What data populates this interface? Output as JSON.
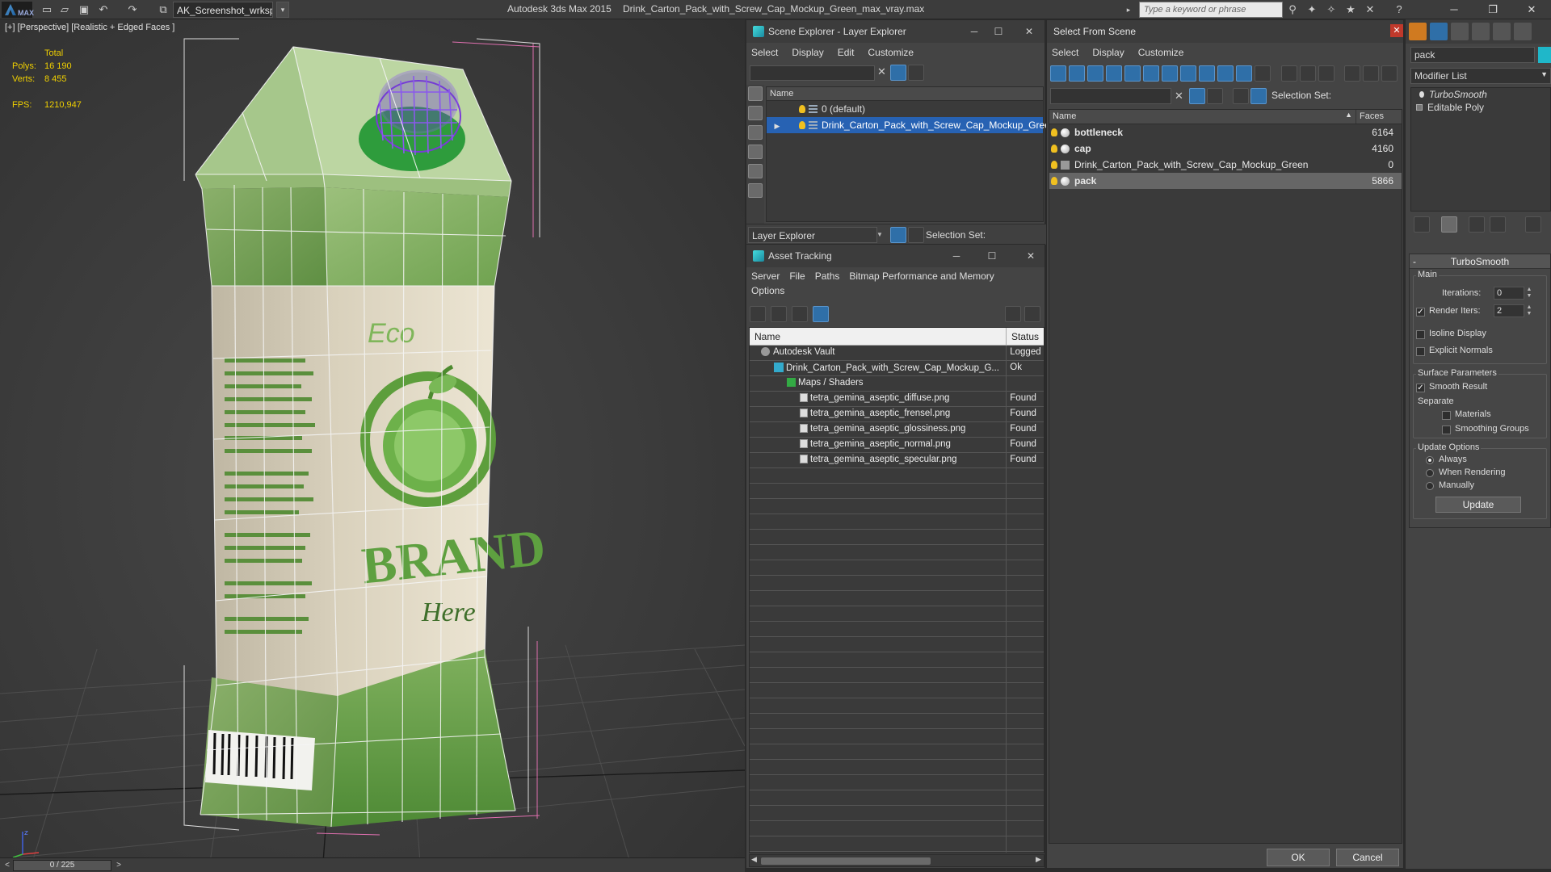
{
  "titlebar": {
    "logo": "MAX",
    "workspace": "AK_Screenshot_wrksp",
    "app_title": "Autodesk 3ds Max  2015",
    "file_title": "Drink_Carton_Pack_with_Screw_Cap_Mockup_Green_max_vray.max",
    "search_placeholder": "Type a keyword or phrase"
  },
  "viewport": {
    "label": "[+] [Perspective] [Realistic + Edged Faces ]",
    "stats": {
      "total_label": "Total",
      "polys_label": "Polys:",
      "polys_value": "16 190",
      "verts_label": "Verts:",
      "verts_value": "8 455",
      "fps_label": "FPS:",
      "fps_value": "1210,947"
    },
    "carton_text": {
      "eco": "Eco",
      "brand": "BRAND",
      "here": "Here"
    },
    "time_slider": "0 / 225"
  },
  "scene_explorer": {
    "title": "Scene Explorer - Layer Explorer",
    "menu": [
      "Select",
      "Display",
      "Edit",
      "Customize"
    ],
    "column": "Name",
    "rows": [
      {
        "label": "0 (default)",
        "selected": false
      },
      {
        "label": "Drink_Carton_Pack_with_Screw_Cap_Mockup_Green",
        "selected": true
      }
    ],
    "mode": "Layer Explorer",
    "selection_set": "Selection Set:"
  },
  "asset_tracking": {
    "title": "Asset Tracking",
    "menu": [
      "Server",
      "File",
      "Paths",
      "Bitmap Performance and Memory"
    ],
    "menu2": "Options",
    "columns": [
      "Name",
      "Status"
    ],
    "rows": [
      {
        "name": "Autodesk Vault",
        "status": "Logged",
        "indent": 1,
        "type": "vault"
      },
      {
        "name": "Drink_Carton_Pack_with_Screw_Cap_Mockup_G...",
        "status": "Ok",
        "indent": 2,
        "type": "max"
      },
      {
        "name": "Maps / Shaders",
        "status": "",
        "indent": 3,
        "type": "group"
      },
      {
        "name": "tetra_gemina_aseptic_diffuse.png",
        "status": "Found",
        "indent": 4,
        "type": "file"
      },
      {
        "name": "tetra_gemina_aseptic_frensel.png",
        "status": "Found",
        "indent": 4,
        "type": "file"
      },
      {
        "name": "tetra_gemina_aseptic_glossiness.png",
        "status": "Found",
        "indent": 4,
        "type": "file"
      },
      {
        "name": "tetra_gemina_aseptic_normal.png",
        "status": "Found",
        "indent": 4,
        "type": "file"
      },
      {
        "name": "tetra_gemina_aseptic_specular.png",
        "status": "Found",
        "indent": 4,
        "type": "file"
      }
    ]
  },
  "select_from_scene": {
    "title": "Select From Scene",
    "menu": [
      "Select",
      "Display",
      "Customize"
    ],
    "selection_set": "Selection Set:",
    "columns": [
      "Name",
      "Faces"
    ],
    "rows": [
      {
        "name": "bottleneck",
        "faces": "6164",
        "bold": true,
        "selected": false,
        "kind": "object"
      },
      {
        "name": "cap",
        "faces": "4160",
        "bold": true,
        "selected": false,
        "kind": "object"
      },
      {
        "name": "Drink_Carton_Pack_with_Screw_Cap_Mockup_Green",
        "faces": "0",
        "bold": false,
        "selected": false,
        "kind": "group"
      },
      {
        "name": "pack",
        "faces": "5866",
        "bold": true,
        "selected": true,
        "kind": "object"
      }
    ],
    "ok": "OK",
    "cancel": "Cancel"
  },
  "command_panel": {
    "object_name": "pack",
    "object_color": "#1fb7c9",
    "modifier_list": "Modifier List",
    "stack": [
      "TurboSmooth",
      "Editable Poly"
    ],
    "turbosmooth": {
      "title": "TurboSmooth",
      "main": "Main",
      "iterations_label": "Iterations:",
      "iterations": "0",
      "render_iters_label": "Render Iters:",
      "render_iters": "2",
      "isoline": "Isoline Display",
      "explicit_normals": "Explicit Normals",
      "surface_params": "Surface Parameters",
      "smooth_result": "Smooth Result",
      "separate": "Separate",
      "materials": "Materials",
      "smoothing_groups": "Smoothing Groups",
      "update_options": "Update Options",
      "always": "Always",
      "when_rendering": "When Rendering",
      "manually": "Manually",
      "update": "Update"
    }
  }
}
